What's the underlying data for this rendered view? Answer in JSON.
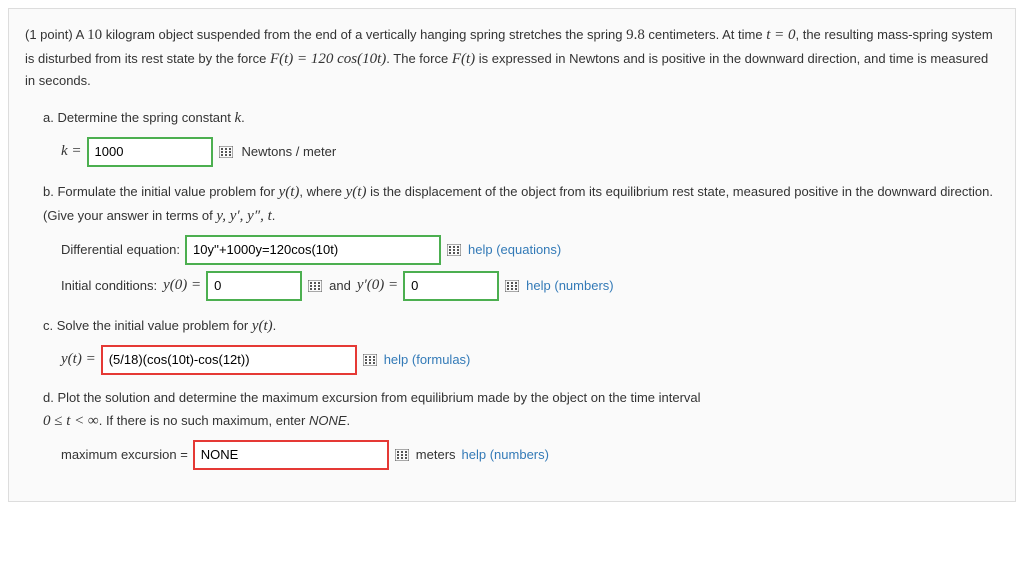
{
  "intro": {
    "points_prefix": "(1 point) A ",
    "mass": "10",
    "text1": " kilogram object suspended from the end of a vertically hanging spring stretches the spring ",
    "stretch": "9.8",
    "text2": " centimeters. At time ",
    "time0": "t = 0",
    "text3": ", the resulting mass-spring system is disturbed from its rest state by the force ",
    "force_eq": "F(t) = 120 cos(10t)",
    "text4": ". The force ",
    "force_sym": "F(t)",
    "text5": " is expressed in Newtons and is positive in the downward direction, and time is measured in seconds."
  },
  "part_a": {
    "label": "a. Determine the spring constant ",
    "kvar": "k",
    "label_end": ".",
    "keq": "k = ",
    "value": "1000",
    "unit": "Newtons / meter"
  },
  "part_b": {
    "label1": "b. Formulate the initial value problem for ",
    "yt": "y(t)",
    "label2": ", where ",
    "label3": " is the displacement of the object from its equilibrium rest state, measured positive in the downward direction. (Give your answer in terms of ",
    "vars": "y, y′, y″, t",
    "label_end": ".",
    "de_label": "Differential equation:",
    "de_value": "10y''+1000y=120cos(10t)",
    "help_eq": "help (equations)",
    "ic_label": "Initial conditions: ",
    "y0": "y(0) = ",
    "y0_value": "0",
    "and": "and ",
    "yp0": "y′(0) = ",
    "yp0_value": "0",
    "help_num": "help (numbers)"
  },
  "part_c": {
    "label": "c. Solve the initial value problem for ",
    "yt": "y(t)",
    "label_end": ".",
    "yteq": "y(t) = ",
    "value": "(5/18)(cos(10t)-cos(12t))",
    "help": "help (formulas)"
  },
  "part_d": {
    "label1": "d. Plot the solution and determine the maximum excursion from equilibrium made by the object on the time interval ",
    "interval": "0 ≤ t < ∞",
    "label2": ". If there is no such maximum, enter ",
    "none_word": "NONE",
    "label_end": ".",
    "max_label": "maximum excursion = ",
    "value": "NONE",
    "unit": "meters ",
    "help": "help (numbers)"
  }
}
